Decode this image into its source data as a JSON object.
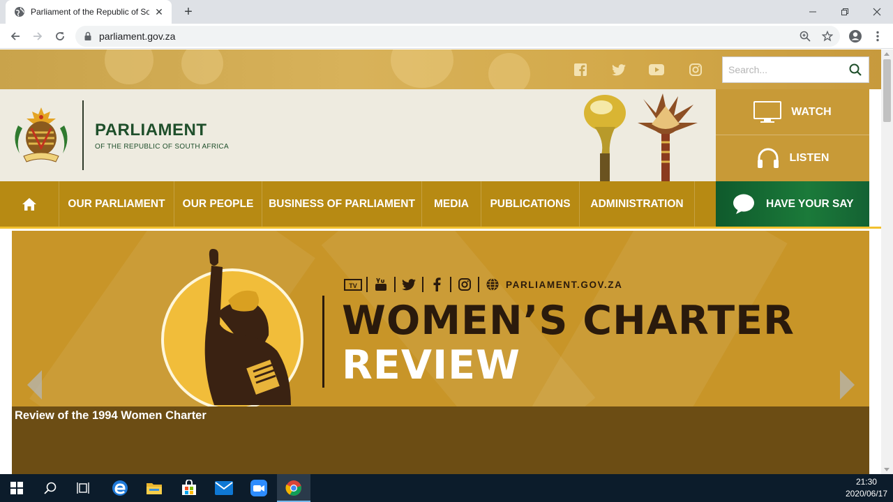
{
  "browser": {
    "tab_title": "Parliament of the Republic of South Africa",
    "url": "parliament.gov.za"
  },
  "site": {
    "search_placeholder": "Search...",
    "brand_title": "PARLIAMENT",
    "brand_subtitle": "OF THE REPUBLIC OF SOUTH AFRICA",
    "watch_label": "WATCH",
    "listen_label": "LISTEN",
    "nav": [
      {
        "label": "OUR PARLIAMENT"
      },
      {
        "label": "OUR PEOPLE"
      },
      {
        "label": "BUSINESS OF PARLIAMENT"
      },
      {
        "label": "MEDIA"
      },
      {
        "label": "PUBLICATIONS"
      },
      {
        "label": "ADMINISTRATION"
      }
    ],
    "have_your_say": "HAVE YOUR SAY"
  },
  "slide": {
    "website": "PARLIAMENT.GOV.ZA",
    "headline_line1": "WOMEN’S CHARTER",
    "headline_line2": "REVIEW",
    "caption": "Review of the 1994 Women Charter"
  },
  "taskbar": {
    "time": "21:30",
    "date": "2020/06/17"
  },
  "colors": {
    "nav_gold": "#b78a13",
    "accent_yellow": "#f2c12e",
    "brand_green": "#1f4f2b",
    "have_your_say_green": "#1b7a3a",
    "slide_gold": "#c89528"
  }
}
